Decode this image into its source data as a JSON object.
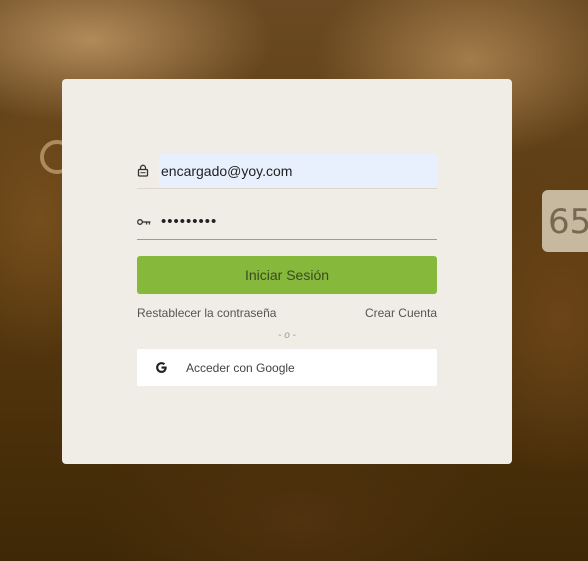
{
  "login": {
    "email_value": "encargado@yoy.com",
    "password_value": "•••••••••",
    "submit_label": "Iniciar Sesión",
    "reset_password_label": "Restablecer la contraseña",
    "create_account_label": "Crear Cuenta",
    "divider_label": "- o -",
    "google_label": "Acceder con Google"
  },
  "background": {
    "ear_tag_text": "65"
  },
  "icons": {
    "email": "lock-icon",
    "password": "key-icon",
    "google": "google-icon"
  },
  "colors": {
    "accent": "#85b83b",
    "card": "#f0ece6",
    "autofill": "#e8f0fe"
  }
}
